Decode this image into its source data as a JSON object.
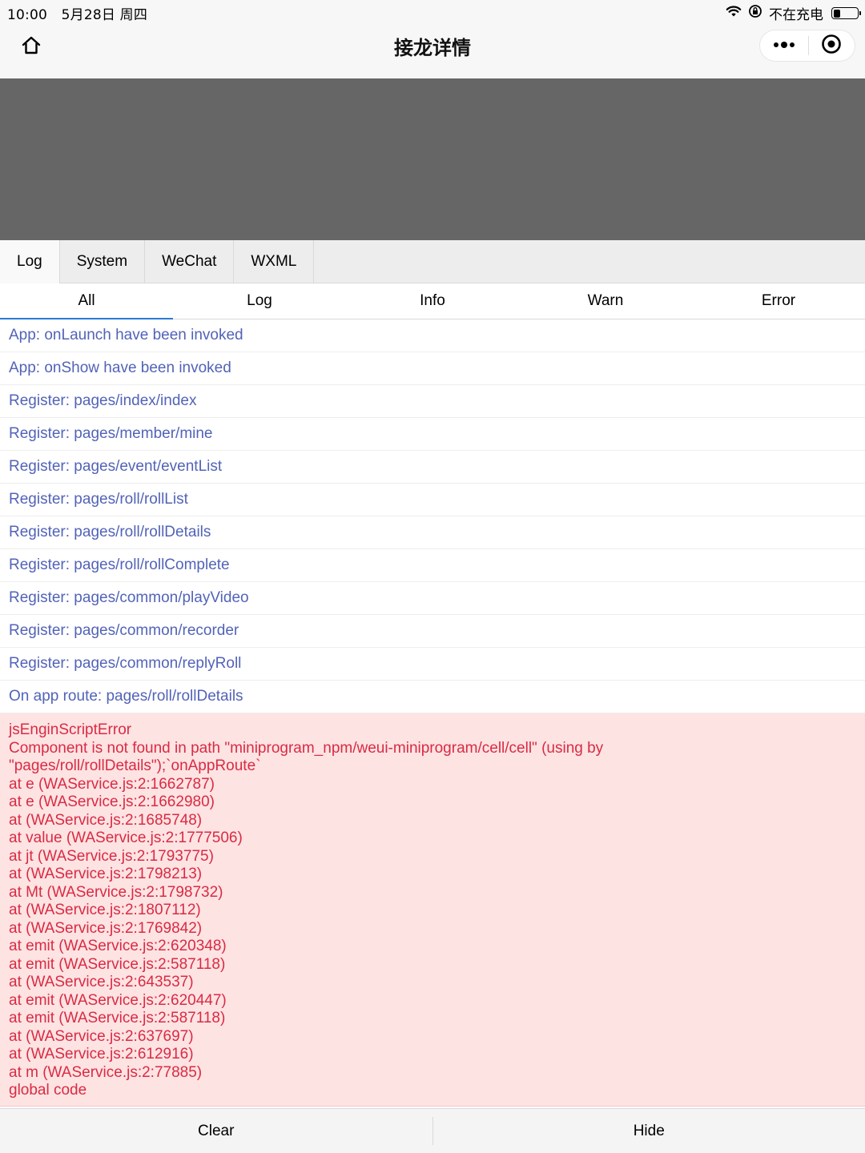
{
  "status_bar": {
    "time": "10:00",
    "date": "5月28日 周四",
    "charging_text": "不在充电",
    "battery_level": 0.3
  },
  "nav": {
    "title": "接龙详情",
    "home_icon": "home-icon",
    "more_icon": "more-dots-icon",
    "close_icon": "close-target-icon"
  },
  "vconsole": {
    "tabs": [
      "Log",
      "System",
      "WeChat",
      "WXML"
    ],
    "active_tab": "Log",
    "subtabs": [
      "All",
      "Log",
      "Info",
      "Warn",
      "Error"
    ],
    "active_subtab": "All",
    "logs": [
      "App: onLaunch have been invoked",
      "App: onShow have been invoked",
      "Register: pages/index/index",
      "Register: pages/member/mine",
      "Register: pages/event/eventList",
      "Register: pages/roll/rollList",
      "Register: pages/roll/rollDetails",
      "Register: pages/roll/rollComplete",
      "Register: pages/common/playVideo",
      "Register: pages/common/recorder",
      "Register: pages/common/replyRoll",
      "On app route: pages/roll/rollDetails"
    ],
    "error_lines": [
      "jsEnginScriptError",
      "Component is not found in path \"miniprogram_npm/weui-miniprogram/cell/cell\" (using by",
      "\"pages/roll/rollDetails\");`onAppRoute`",
      "at e (WAService.js:2:1662787)",
      "at e (WAService.js:2:1662980)",
      "at (WAService.js:2:1685748)",
      "at value (WAService.js:2:1777506)",
      "at jt (WAService.js:2:1793775)",
      "at (WAService.js:2:1798213)",
      "at Mt (WAService.js:2:1798732)",
      "at (WAService.js:2:1807112)",
      "at (WAService.js:2:1769842)",
      "at emit (WAService.js:2:620348)",
      "at emit (WAService.js:2:587118)",
      "at (WAService.js:2:643537)",
      "at emit (WAService.js:2:620447)",
      "at emit (WAService.js:2:587118)",
      "at (WAService.js:2:637697)",
      "at (WAService.js:2:612916)",
      "at m (WAService.js:2:77885)",
      "global code"
    ],
    "toolbar": {
      "clear_label": "Clear",
      "hide_label": "Hide"
    },
    "colors": {
      "log_text": "#5263b8",
      "error_text": "#d92b43",
      "error_bg": "#fee3e3",
      "panel_overlay": "#666666"
    }
  }
}
